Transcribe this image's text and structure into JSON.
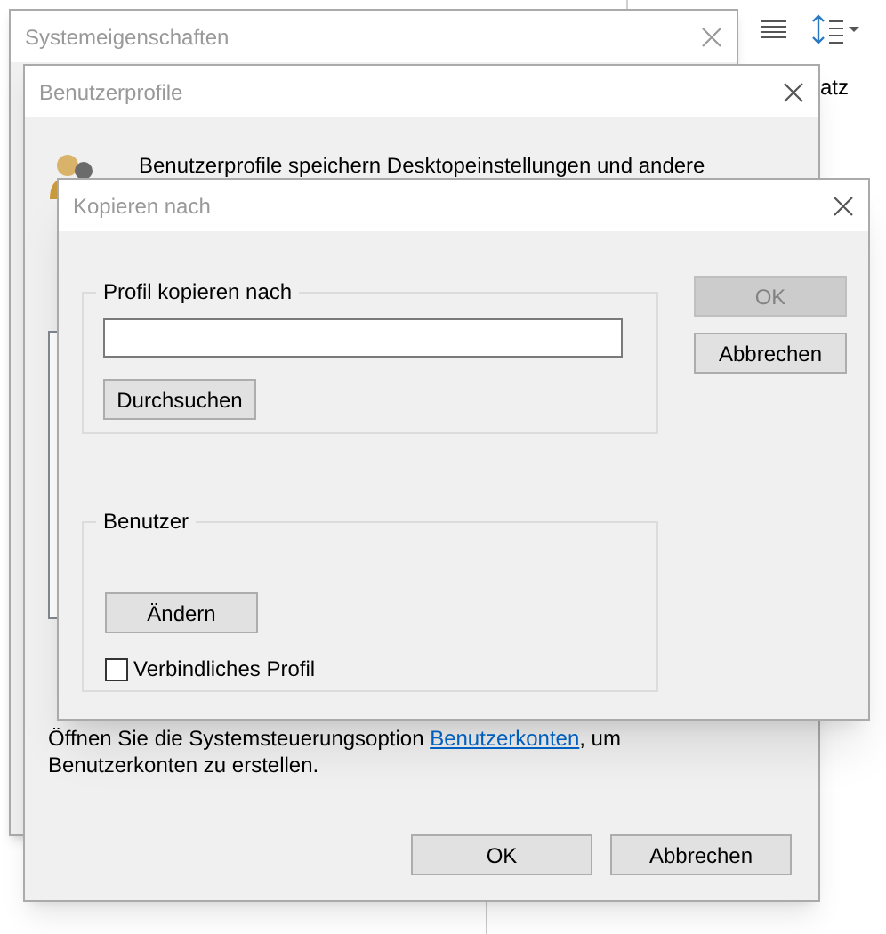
{
  "background": {
    "toolbar_text": "atz"
  },
  "system_window": {
    "title": "Systemeigenschaften"
  },
  "profiles_window": {
    "title": "Benutzerprofile",
    "intro": "Benutzerprofile speichern Desktopeinstellungen und andere",
    "footer_before": "Öffnen Sie die Systemsteuerungsoption ",
    "footer_link": "Benutzerkonten",
    "footer_after": ", um Benutzerkonten zu erstellen.",
    "buttons": [
      "OK",
      "Abbrechen"
    ]
  },
  "copy_dialog": {
    "title": "Kopieren nach",
    "target_group": {
      "label": "Profil kopieren nach",
      "browse_button": "Durchsuchen"
    },
    "user_group": {
      "label": "Benutzer",
      "change_button": "Ändern",
      "mandatory": {
        "label": "Verbindliches Profil",
        "checked": false
      }
    },
    "buttons": [
      {
        "label": "OK",
        "disabled": true
      },
      {
        "label": "Abbrechen",
        "disabled": false
      }
    ]
  }
}
